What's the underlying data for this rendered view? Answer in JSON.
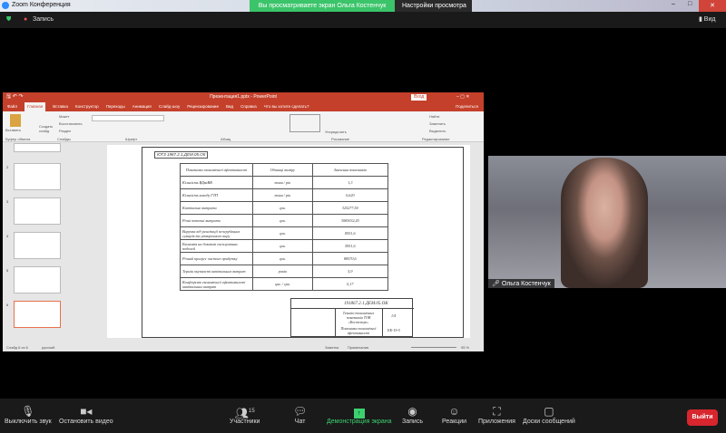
{
  "zoom": {
    "window_title": "Zoom Конференция",
    "share_banner": "Вы просматриваете экран Ольга Костенчук",
    "view_settings": "Настройки просмотра",
    "recording": "Запись",
    "view": "Вид"
  },
  "ppt": {
    "title": "Презентация1.pptx - PowerPoint",
    "login": "Вход",
    "share": "Поделиться",
    "tabs": [
      "Файл",
      "Главная",
      "Вставка",
      "Конструктор",
      "Переходы",
      "Анимация",
      "Слайд-шоу",
      "Рецензирование",
      "Вид",
      "Справка",
      "Что вы хотите сделать?"
    ],
    "ribbon": {
      "paste": "Вставить",
      "clipboard": "Буфер обмена",
      "new_slide": "Создать слайд",
      "layout": "Макет",
      "reset": "Восстановить",
      "section": "Раздел",
      "slides": "Слайды",
      "font": "Шрифт",
      "paragraph": "Абзац",
      "drawing": "Рисование",
      "arrange": "Упорядочить",
      "find": "Найти",
      "replace": "Заменить",
      "select": "Выделить",
      "editing": "Редактирование"
    },
    "status": {
      "slide": "Слайд 6 из 6",
      "lang": "русский",
      "notes": "Заметки",
      "comments": "Примечания",
      "zoom": "95 %"
    },
    "thumb_numbers": [
      "2",
      "3",
      "4",
      "5",
      "6"
    ]
  },
  "slide": {
    "code": "ЮТЗ 1987.2.1.ДЕМ.05.ОК",
    "headers": [
      "Показники економічної ефективності",
      "Одиниці виміру",
      "Значення показників"
    ],
    "rows": [
      [
        "Кількість ВДваВВ",
        "тонн / рік",
        "1,3"
      ],
      [
        "Кількість виходу ГТП",
        "тонн / рік",
        "0,620"
      ],
      [
        "Капітальні витрати",
        "грн.",
        "325277,50"
      ],
      [
        "Річні поточні витрати",
        "грн.",
        "3083032,43"
      ],
      [
        "Виручка від реалізації печерубльних сумарів та утворенного виру",
        "грн.",
        "8551,6"
      ],
      [
        "Економія на доказові експлуатних подолей",
        "грн.",
        "5951,6"
      ],
      [
        "Річний прогрес чистого прибутку",
        "грн.",
        "88570,6"
      ],
      [
        "Термін окупності капітальних витрат",
        "років",
        "5,9"
      ],
      [
        "Коефіцієнт економічної ефективності капітальних витрат",
        "грн. / грн.",
        "0,17"
      ]
    ],
    "stamp_code": "191867.2.1.ДЕМ.05.ОК",
    "stamp_title": "Техніко-економічних показників ТОВ «Костенчук»",
    "stamp_sub": "Показники економічної ефективності",
    "stamp_group": "ЕК-19-5",
    "stamp_sheet": "1/4"
  },
  "video": {
    "name": "Ольга Костенчук"
  },
  "toolbar": {
    "mute": "Выключить звук",
    "video": "Остановить видео",
    "participants": "Участники",
    "participants_count": "15",
    "chat": "Чат",
    "share": "Демонстрация экрана",
    "record": "Запись",
    "reactions": "Реакции",
    "apps": "Приложения",
    "whiteboards": "Доски сообщений",
    "leave": "Выйти"
  }
}
